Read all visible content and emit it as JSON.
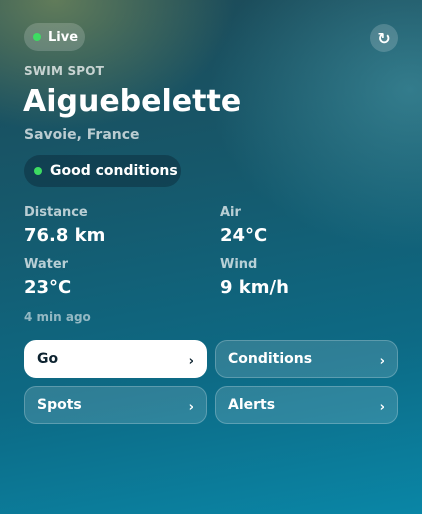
{
  "header": {
    "live_label": "Live",
    "refresh_icon": "↻"
  },
  "spot": {
    "eyebrow": "SWIM SPOT",
    "name": "Aiguebelette",
    "location": "Savoie, France",
    "conditions": "Good conditions"
  },
  "stats": {
    "distance": {
      "label": "Distance",
      "value": "76.8 km"
    },
    "air": {
      "label": "Air",
      "value": "24°C"
    },
    "water": {
      "label": "Water",
      "value": "23°C"
    },
    "wind": {
      "label": "Wind",
      "value": "9 km/h"
    }
  },
  "updated": "4 min ago",
  "actions": {
    "go": "Go",
    "conditions": "Conditions",
    "spots": "Spots",
    "alerts": "Alerts",
    "chevron": "›"
  },
  "colors": {
    "status_green": "#3ddc62",
    "primary_button": "#ffffff",
    "primary_text": "#0d2330"
  }
}
